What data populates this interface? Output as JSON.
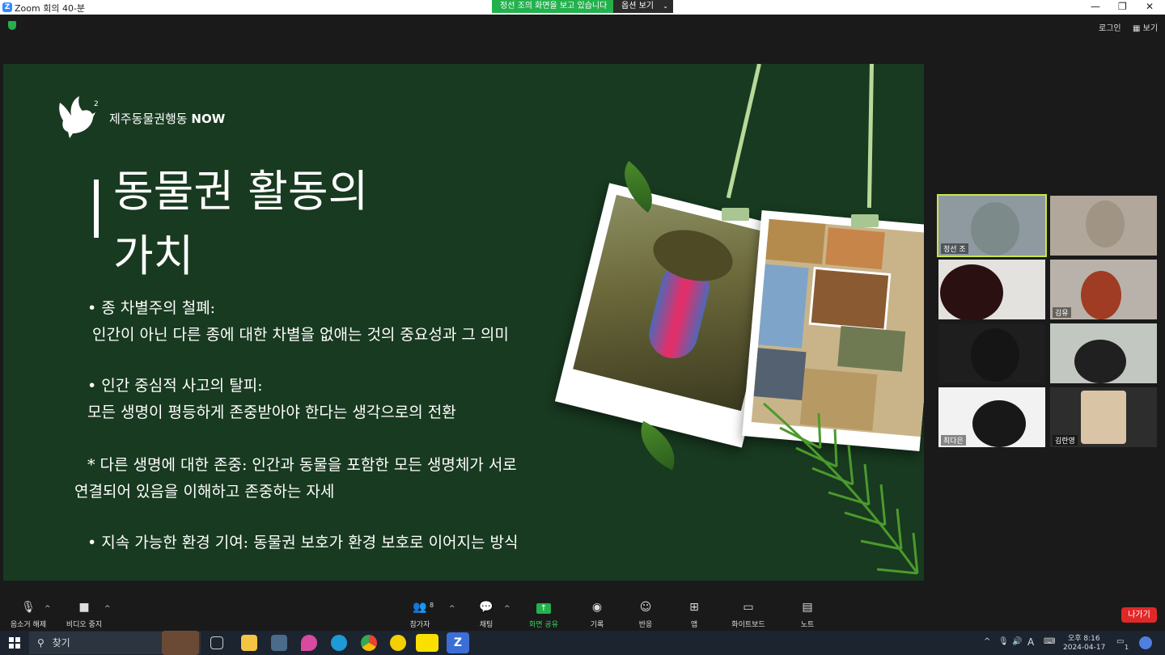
{
  "window": {
    "title": "Zoom 회의 40-분",
    "app_icon": "zoom-icon"
  },
  "share_banner": {
    "text": "정선 조의 화면을 보고 있습니다",
    "options_label": "옵션 보기"
  },
  "window_controls": {
    "minimize": "—",
    "restore": "❐",
    "close": "✕"
  },
  "top_right": {
    "login": "로그인",
    "view": "보기"
  },
  "slide": {
    "org_name": "제주동물권행동",
    "org_suffix": "NOW",
    "title_line1": "동물권 활동의",
    "title_line2": "가치",
    "lines": [
      "• 종 차별주의 철폐:",
      "인간이 아닌 다른 종에 대한 차별을 없애는 것의 중요성과 그 의미",
      "• 인간 중심적 사고의 탈피:",
      "모든 생명이 평등하게 존중받아야 한다는 생각으로의 전환",
      "* 다른 생명에 대한 존중: 인간과 동물을 포함한 모든 생명체가  서로",
      "연결되어 있음을 이해하고 존중하는 자세",
      "• 지속 가능한 환경 기여: 동물권 보호가 환경 보호로 이어지는 방식"
    ],
    "colors": {
      "background": "#183a20",
      "string": "#b8d99a"
    }
  },
  "slide_controls": [
    "◀",
    "▶",
    "✎",
    "▣",
    "⚲",
    "•••"
  ],
  "participants": {
    "tiles": [
      {
        "name": "정선 조"
      },
      {
        "name": ""
      },
      {
        "name": ""
      },
      {
        "name": "김유"
      },
      {
        "name": ""
      },
      {
        "name": ""
      },
      {
        "name": "최다은"
      },
      {
        "name": "김란영"
      }
    ]
  },
  "toolbar": {
    "unmute": "음소거 해제",
    "stop_video": "비디오 중지",
    "participants": "참가자",
    "participants_count": "8",
    "chat": "채팅",
    "share_screen": "화면 공유",
    "record": "기록",
    "reactions": "반응",
    "apps": "앱",
    "whiteboard": "화이트보드",
    "notes": "노트",
    "leave": "나가기"
  },
  "taskbar": {
    "search": "찾기",
    "time": "오후 8:16",
    "date": "2024-04-17",
    "ime": "A",
    "notification_count": "1"
  }
}
